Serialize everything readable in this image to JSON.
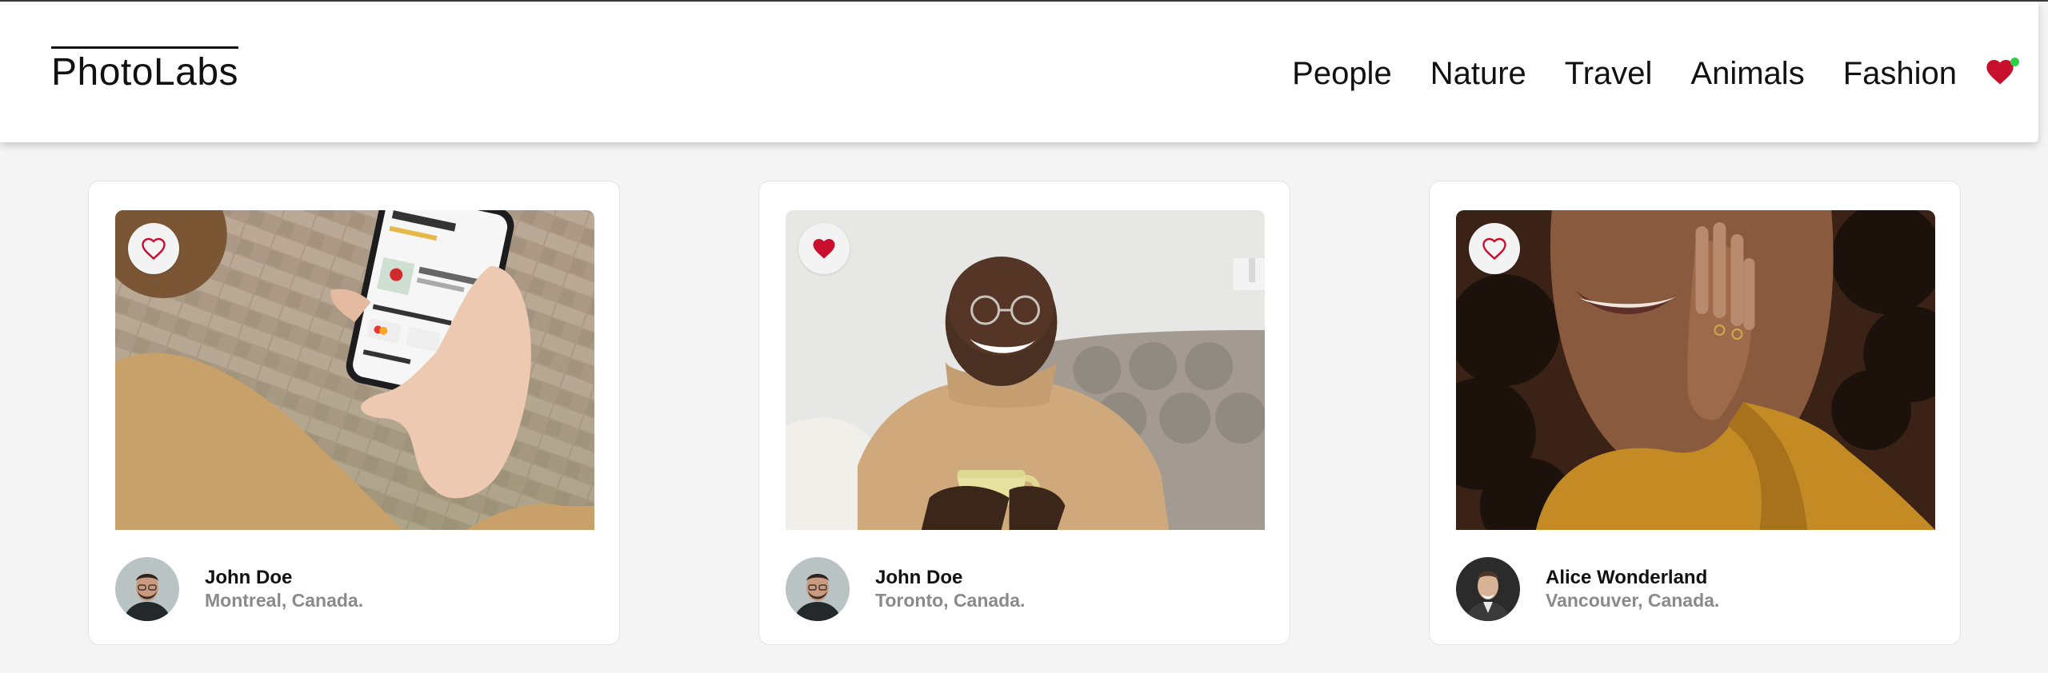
{
  "app": {
    "logo": "PhotoLabs"
  },
  "nav": {
    "topics": [
      "People",
      "Nature",
      "Travel",
      "Animals",
      "Fashion"
    ],
    "fav_badge": {
      "icon": "heart-icon",
      "has_notification": true,
      "color": "#c8102e",
      "dot_color": "#2fcf45"
    }
  },
  "photos": [
    {
      "user": {
        "name": "John Doe",
        "location": "Montreal, Canada."
      },
      "liked": false,
      "image": "hand-holding-phone-photo"
    },
    {
      "user": {
        "name": "John Doe",
        "location": "Toronto, Canada."
      },
      "liked": true,
      "image": "smiling-man-with-mug-photo"
    },
    {
      "user": {
        "name": "Alice Wonderland",
        "location": "Vancouver, Canada."
      },
      "liked": false,
      "image": "woman-yellow-sweater-photo"
    }
  ],
  "colors": {
    "accent": "#c8102e",
    "background": "#f4f4f4",
    "muted_text": "#8a8a8a"
  }
}
